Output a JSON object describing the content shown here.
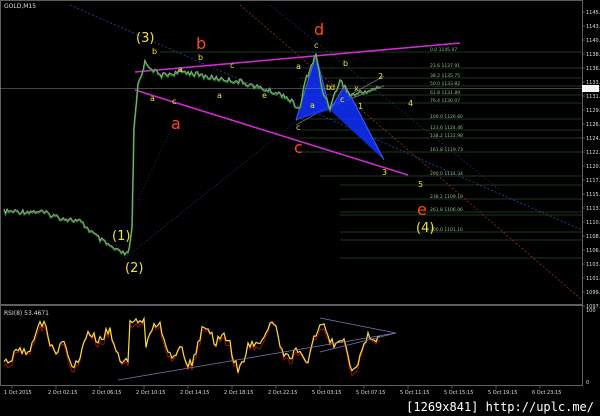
{
  "window": {
    "title": "GOLD,M15",
    "rsi_title": "RSI(8) 53.4671",
    "watermark": "[1269x841] http://uplc.me/"
  },
  "price_axis": {
    "ticks": [
      "1145.4",
      "1143.1",
      "1140.8",
      "1138.5",
      "1136.2",
      "1133.8",
      "1131.5",
      "1129.2",
      "1126.9",
      "1124.6",
      "1122.3",
      "1120.0",
      "1117.7",
      "1115.4",
      "1113.0",
      "1110.7",
      "1108.4",
      "1106.1",
      "1103.8",
      "1101.5",
      "1099.2",
      "1097.0"
    ],
    "current_price": "1135.3"
  },
  "rsi_axis": {
    "ticks": [
      "100",
      "0"
    ]
  },
  "time_axis": {
    "labels": [
      "1 Oct 2015",
      "2 Oct 02:15",
      "2 Oct 06:15",
      "2 Oct 10:15",
      "2 Oct 14:15",
      "2 Oct 18:15",
      "2 Oct 22:15",
      "5 Oct 03:15",
      "5 Oct 07:15",
      "5 Oct 11:15",
      "5 Oct 15:15",
      "5 Oct 19:15",
      "6 Oct 23:15"
    ]
  },
  "fib_labels": [
    "0.0 1145.07",
    "23.6 1137.91",
    "38.2 1135.75",
    "50.0 1133.82",
    "61.8 1131.89",
    "76.4 1130.07",
    "100.0 1126.60",
    "123.6 1124.46",
    "138.2 1122.98",
    "161.8 1119.73",
    "200.0 1114.34",
    "238.2 1109.10",
    "261.8 1106.06",
    "300.0 1101.10"
  ],
  "wave_labels": {
    "big": [
      {
        "text": "(3)",
        "color": "#f0e040"
      },
      {
        "text": "b",
        "color": "#ff4a1a"
      },
      {
        "text": "d",
        "color": "#ff4a1a"
      },
      {
        "text": "a",
        "color": "#ff4a1a"
      },
      {
        "text": "c",
        "color": "#ff4a1a"
      },
      {
        "text": "(1)",
        "color": "#f0e040"
      },
      {
        "text": "(2)",
        "color": "#f0e040"
      },
      {
        "text": "e",
        "color": "#ff4a1a"
      },
      {
        "text": "(4)",
        "color": "#f0e040"
      }
    ],
    "small": [
      {
        "text": "b",
        "color": "#f0e040"
      },
      {
        "text": "a",
        "color": "#f0e040"
      },
      {
        "text": "c",
        "color": "#f0e040"
      },
      {
        "text": "b",
        "color": "#f0e040"
      },
      {
        "text": "a",
        "color": "#f0e040"
      },
      {
        "text": "c",
        "color": "#f0e040"
      },
      {
        "text": "a",
        "color": "#f0e040"
      },
      {
        "text": "e",
        "color": "#f0e040"
      },
      {
        "text": "a",
        "color": "#f0e040"
      },
      {
        "text": "c",
        "color": "#f0e040"
      },
      {
        "text": "b",
        "color": "#f0e040"
      },
      {
        "text": "d",
        "color": "#f0e040"
      },
      {
        "text": "1",
        "color": "#f0e040"
      },
      {
        "text": "2",
        "color": "#f0e040"
      },
      {
        "text": "3",
        "color": "#f0e040"
      },
      {
        "text": "4",
        "color": "#f0e040"
      },
      {
        "text": "5",
        "color": "#f0e040"
      },
      {
        "text": "a",
        "color": "#f0e040"
      },
      {
        "text": "b",
        "color": "#f0e040"
      },
      {
        "text": "c",
        "color": "#f0e040"
      },
      {
        "text": "x",
        "color": "#f0e040"
      },
      {
        "text": "c",
        "color": "#f0e040"
      }
    ]
  },
  "colors": {
    "background": "#000000",
    "price_line": "#b8b8b8",
    "ma_line": "#2e8b2e",
    "trendline": "#d22ad2",
    "harmonic_fill": "#1030ff",
    "rsi_line": "#f0e040",
    "rsi_signal": "#c01010",
    "fib": "#3a6e3a",
    "grid_axis": "#888888"
  },
  "chart_data": {
    "type": "line",
    "symbol": "GOLD",
    "timeframe": "M15",
    "ylim": [
      1097.0,
      1145.4
    ],
    "current_price": 1135.3,
    "indicator": {
      "name": "RSI(8)",
      "value": 53.4671
    }
  }
}
